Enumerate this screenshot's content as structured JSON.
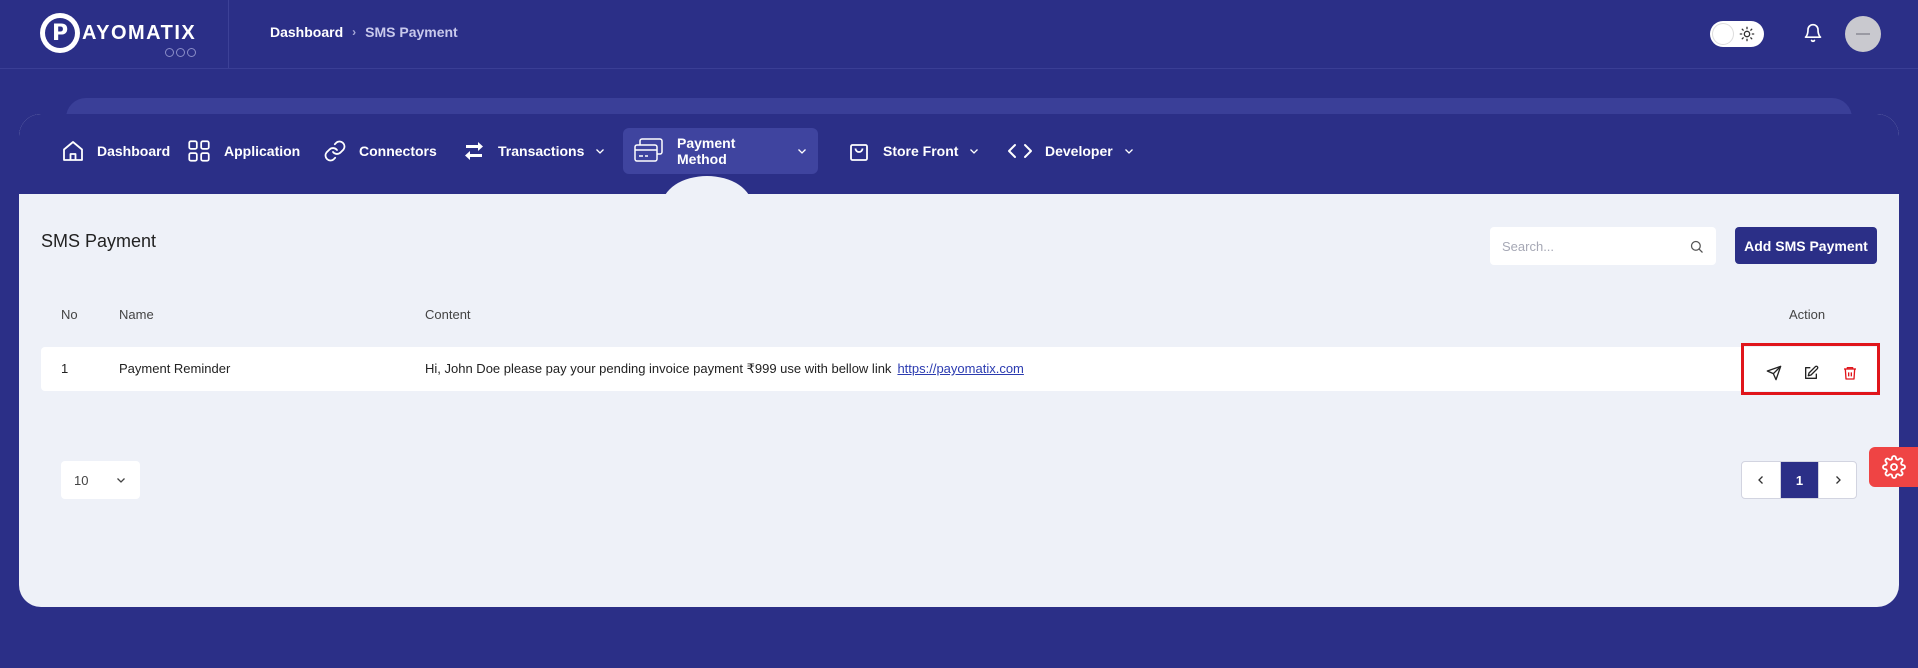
{
  "brand": {
    "name": "AYOMATIX",
    "initial": "P"
  },
  "breadcrumb": {
    "home": "Dashboard",
    "separator": "›",
    "current": "SMS Payment"
  },
  "nav": {
    "items": [
      {
        "label": "Dashboard",
        "icon": "home-icon",
        "dropdown": false,
        "active": false
      },
      {
        "label": "Application",
        "icon": "grid-icon",
        "dropdown": false,
        "active": false
      },
      {
        "label": "Connectors",
        "icon": "link-icon",
        "dropdown": false,
        "active": false
      },
      {
        "label": "Transactions",
        "icon": "swap-arrows-icon",
        "dropdown": true,
        "active": false
      },
      {
        "label": "Payment Method",
        "icon": "credit-cards-icon",
        "dropdown": true,
        "active": true
      },
      {
        "label": "Store Front",
        "icon": "shopping-bag-icon",
        "dropdown": true,
        "active": false
      },
      {
        "label": "Developer",
        "icon": "code-icon",
        "dropdown": true,
        "active": false
      }
    ]
  },
  "page": {
    "title": "SMS Payment",
    "search_placeholder": "Search...",
    "add_button": "Add SMS Payment"
  },
  "table": {
    "headers": {
      "no": "No",
      "name": "Name",
      "content": "Content",
      "action": "Action"
    },
    "rows": [
      {
        "no": "1",
        "name": "Payment Reminder",
        "content": "Hi, John Doe please pay your pending invoice payment ₹999 use with bellow link",
        "link": "https://payomatix.com"
      }
    ]
  },
  "pagination": {
    "per_page": "10",
    "current_page": "1"
  },
  "colors": {
    "primary": "#2b2f87",
    "danger": "#e0151b",
    "surface": "#eef1f8"
  }
}
